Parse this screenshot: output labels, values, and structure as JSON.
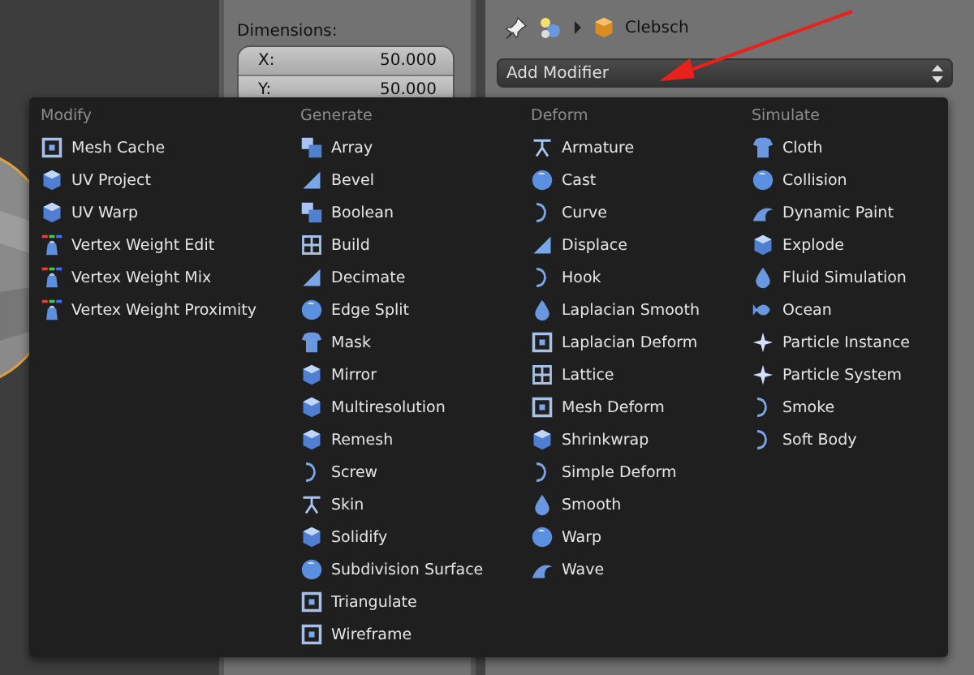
{
  "properties_header": {
    "object_name": "Clebsch"
  },
  "add_modifier": {
    "label": "Add Modifier"
  },
  "dimensions": {
    "label": "Dimensions:",
    "fields": [
      {
        "label": "X:",
        "value": "50.000"
      },
      {
        "label": "Y:",
        "value": "50.000"
      }
    ]
  },
  "modifier_menu": {
    "columns": [
      {
        "title": "Modify",
        "items": [
          "Mesh Cache",
          "UV Project",
          "UV Warp",
          "Vertex Weight Edit",
          "Vertex Weight Mix",
          "Vertex Weight Proximity"
        ]
      },
      {
        "title": "Generate",
        "items": [
          "Array",
          "Bevel",
          "Boolean",
          "Build",
          "Decimate",
          "Edge Split",
          "Mask",
          "Mirror",
          "Multiresolution",
          "Remesh",
          "Screw",
          "Skin",
          "Solidify",
          "Subdivision Surface",
          "Triangulate",
          "Wireframe"
        ]
      },
      {
        "title": "Deform",
        "items": [
          "Armature",
          "Cast",
          "Curve",
          "Displace",
          "Hook",
          "Laplacian Smooth",
          "Laplacian Deform",
          "Lattice",
          "Mesh Deform",
          "Shrinkwrap",
          "Simple Deform",
          "Smooth",
          "Warp",
          "Wave"
        ]
      },
      {
        "title": "Simulate",
        "items": [
          "Cloth",
          "Collision",
          "Dynamic Paint",
          "Explode",
          "Fluid Simulation",
          "Ocean",
          "Particle Instance",
          "Particle System",
          "Smoke",
          "Soft Body"
        ]
      }
    ]
  }
}
